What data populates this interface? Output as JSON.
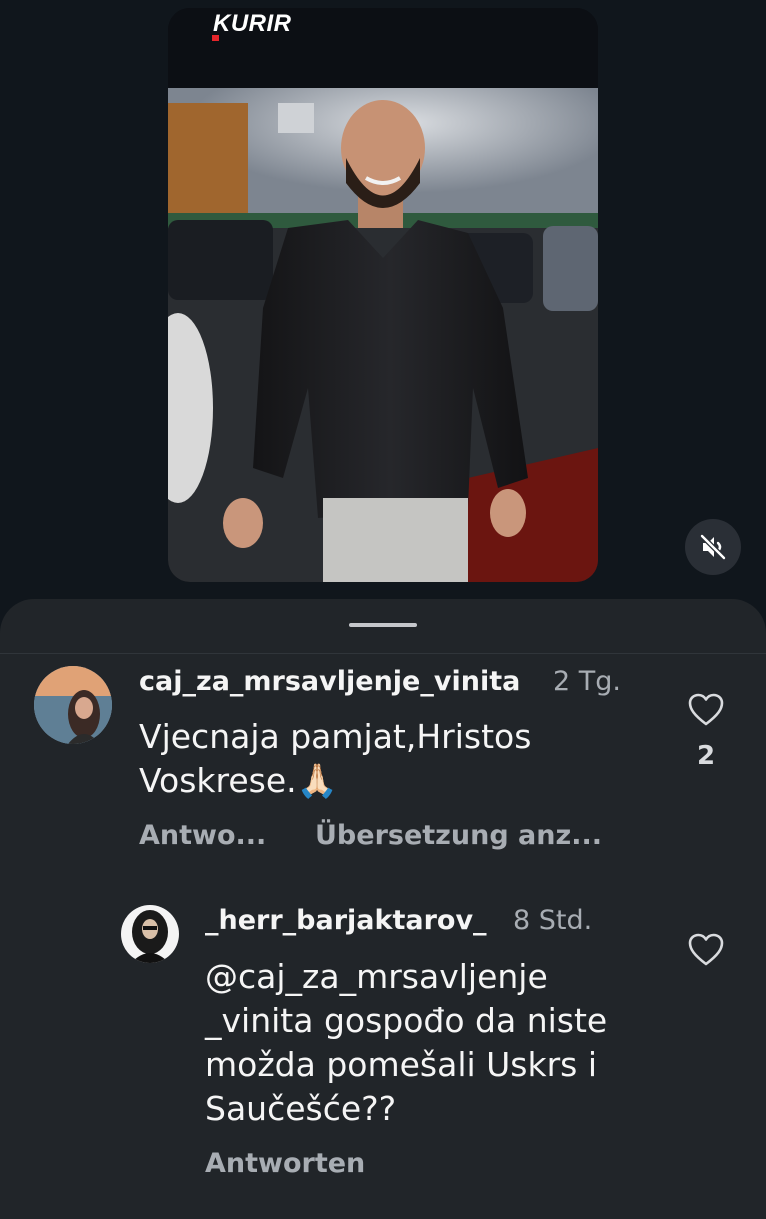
{
  "video": {
    "brand": "KURIR"
  },
  "comments": [
    {
      "username": "caj_za_mrsavljenje_vinita",
      "time": "2 Tg.",
      "text_line1": "Vjecnaja pamjat,Hristos",
      "text_line2": "Voskrese.🙏🏻",
      "reply_label": "Antwo...",
      "translate_label": "Übersetzung anz...",
      "likes": "2"
    },
    {
      "username": "_herr_barjaktarov_",
      "time": "8 Std.",
      "mention_line1": "@caj_za_mrsavljenje",
      "mention_line2": "_vinita",
      "text_line2_rest": " gospođo da niste",
      "text_line3": "možda pomešali Uskrs i",
      "text_line4": "Saučešće??",
      "reply_label": "Antworten"
    }
  ],
  "colors": {
    "sheet": "#212529",
    "background": "#10161c",
    "muted_text": "#a8adb3",
    "brand_red": "#e5252a"
  },
  "icons": [
    "volume-off-icon",
    "heart-outline-icon"
  ]
}
